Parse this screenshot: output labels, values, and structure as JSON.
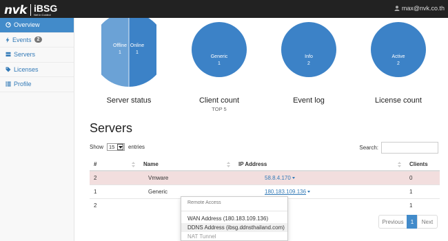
{
  "header": {
    "logo_text": "nvk",
    "product": "iBSG",
    "tagline": "Net in Control",
    "user": "max@nvk.co.th"
  },
  "sidebar": {
    "items": [
      {
        "label": "Overview",
        "icon": "dashboard-icon",
        "active": true
      },
      {
        "label": "Events",
        "icon": "bolt-icon",
        "badge": "2"
      },
      {
        "label": "Servers",
        "icon": "server-icon"
      },
      {
        "label": "Licenses",
        "icon": "tag-icon"
      },
      {
        "label": "Profile",
        "icon": "list-icon"
      }
    ]
  },
  "charts": [
    {
      "label": "Server status",
      "sub": "",
      "slices": [
        {
          "name": "Offline",
          "value": "1",
          "color": "#6ba2d6"
        },
        {
          "name": "Online",
          "value": "1",
          "color": "#3c82c7"
        }
      ]
    },
    {
      "label": "Client count",
      "sub": "TOP 5",
      "slices": [
        {
          "name": "Generic",
          "value": "1",
          "color": "#3c82c7"
        }
      ]
    },
    {
      "label": "Event log",
      "sub": "",
      "slices": [
        {
          "name": "Info",
          "value": "2",
          "color": "#3c82c7"
        }
      ]
    },
    {
      "label": "License count",
      "sub": "",
      "slices": [
        {
          "name": "Active",
          "value": "2",
          "color": "#3c82c7"
        }
      ]
    }
  ],
  "servers": {
    "title": "Servers",
    "show_label": "Show",
    "page_size": "15",
    "entries_label": "entries",
    "search_label": "Search:",
    "columns": [
      "#",
      "Name",
      "IP Address",
      "Clients"
    ],
    "rows": [
      {
        "num": "2",
        "name": "Vmware",
        "ip": "58.8.4.170",
        "clients": "0"
      },
      {
        "num": "1",
        "name": "Generic",
        "ip": "180.183.109.136",
        "clients": "1"
      },
      {
        "num": "2",
        "name": "",
        "ip": "",
        "clients": "1"
      }
    ]
  },
  "dropdown": {
    "header": "Remote Access",
    "items": [
      "WAN Address (180.183.109.136)",
      "DDNS Address (ibsg.ddnsthailand.com)",
      "NAT Tunnel"
    ]
  },
  "pagination": {
    "prev": "Previous",
    "page": "1",
    "next": "Next"
  },
  "colors": {
    "accent": "#428bca",
    "danger_row": "#f2dede",
    "topbar": "#222222"
  }
}
